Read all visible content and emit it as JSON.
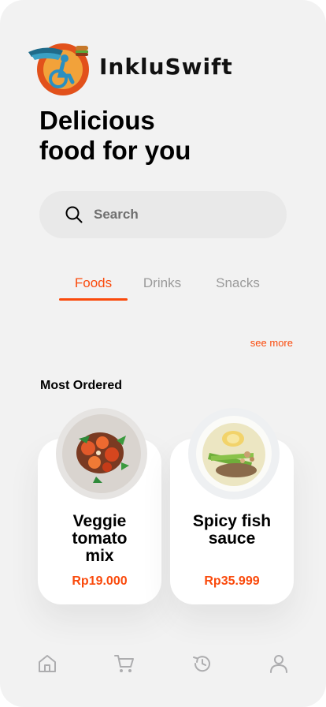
{
  "app": {
    "brand": "InkluSwift"
  },
  "headline": {
    "line1": "Delicious",
    "line2": "food for you"
  },
  "search": {
    "placeholder": "Search"
  },
  "tabs": [
    {
      "label": "Foods",
      "active": true
    },
    {
      "label": "Drinks",
      "active": false
    },
    {
      "label": "Snacks",
      "active": false
    }
  ],
  "see_more": "see more",
  "section": {
    "title": "Most Ordered"
  },
  "items": [
    {
      "name": "Veggie tomato mix",
      "price": "Rp19.000"
    },
    {
      "name": "Spicy fish sauce",
      "price": "Rp35.999"
    }
  ],
  "nav": {
    "items": [
      {
        "icon": "home-icon"
      },
      {
        "icon": "cart-icon"
      },
      {
        "icon": "history-icon"
      },
      {
        "icon": "profile-icon"
      }
    ]
  },
  "colors": {
    "accent": "#fa4a0c",
    "background": "#f2f2f2",
    "card": "#ffffff",
    "muted": "#9a9a9a"
  }
}
